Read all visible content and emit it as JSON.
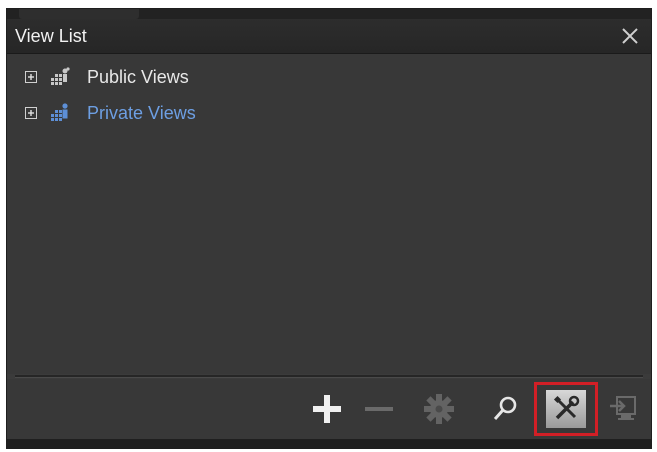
{
  "window": {
    "title": "View List",
    "close_icon": "close-icon"
  },
  "tree": {
    "items": [
      {
        "label": "Public Views",
        "expander": "+",
        "icon": "public-views-icon",
        "color": "#e8e8e8"
      },
      {
        "label": "Private Views",
        "expander": "+",
        "icon": "private-views-icon",
        "color": "#6d9fe3"
      }
    ]
  },
  "toolbar": {
    "buttons": [
      {
        "icon": "add-icon",
        "enabled": true
      },
      {
        "icon": "remove-icon",
        "enabled": false
      },
      {
        "icon": "settings-icon",
        "enabled": false
      },
      {
        "icon": "search-icon",
        "enabled": true
      },
      {
        "icon": "tools-icon",
        "enabled": true,
        "highlighted": true
      },
      {
        "icon": "export-icon",
        "enabled": false
      }
    ],
    "highlight_color": "#d21f26"
  }
}
